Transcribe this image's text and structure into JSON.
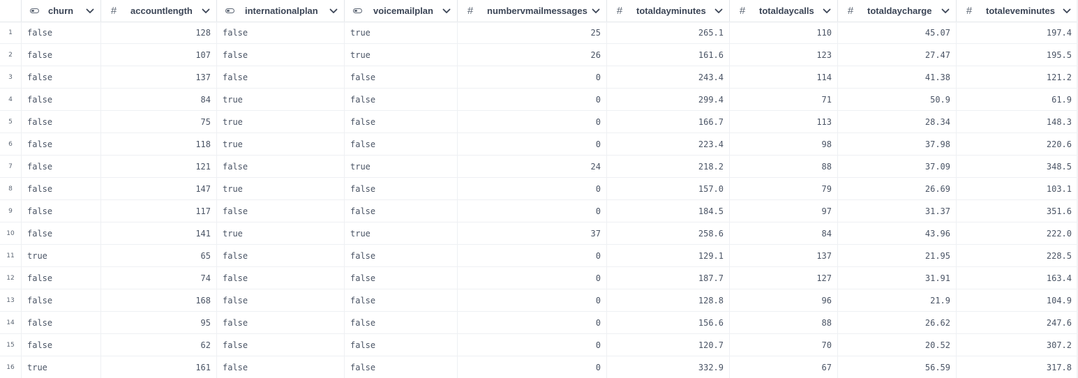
{
  "columns": [
    {
      "key": "churn",
      "label": "churn",
      "type": "boolean",
      "align": "left"
    },
    {
      "key": "accountlength",
      "label": "accountlength",
      "type": "number",
      "align": "right"
    },
    {
      "key": "internationalplan",
      "label": "internationalplan",
      "type": "boolean",
      "align": "left"
    },
    {
      "key": "voicemailplan",
      "label": "voicemailplan",
      "type": "boolean",
      "align": "left"
    },
    {
      "key": "numbervmailmessages",
      "label": "numbervmailmessages",
      "type": "number",
      "align": "right"
    },
    {
      "key": "totaldayminutes",
      "label": "totaldayminutes",
      "type": "number",
      "align": "right"
    },
    {
      "key": "totaldaycalls",
      "label": "totaldaycalls",
      "type": "number",
      "align": "right"
    },
    {
      "key": "totaldaycharge",
      "label": "totaldaycharge",
      "type": "number",
      "align": "right"
    },
    {
      "key": "totaleveminutes",
      "label": "totaleveminutes",
      "type": "number",
      "align": "right"
    }
  ],
  "rows": [
    {
      "index": "1",
      "cells": [
        "false",
        "128",
        "false",
        "true",
        "25",
        "265.1",
        "110",
        "45.07",
        "197.4"
      ]
    },
    {
      "index": "2",
      "cells": [
        "false",
        "107",
        "false",
        "true",
        "26",
        "161.6",
        "123",
        "27.47",
        "195.5"
      ]
    },
    {
      "index": "3",
      "cells": [
        "false",
        "137",
        "false",
        "false",
        "0",
        "243.4",
        "114",
        "41.38",
        "121.2"
      ]
    },
    {
      "index": "4",
      "cells": [
        "false",
        "84",
        "true",
        "false",
        "0",
        "299.4",
        "71",
        "50.9",
        "61.9"
      ]
    },
    {
      "index": "5",
      "cells": [
        "false",
        "75",
        "true",
        "false",
        "0",
        "166.7",
        "113",
        "28.34",
        "148.3"
      ]
    },
    {
      "index": "6",
      "cells": [
        "false",
        "118",
        "true",
        "false",
        "0",
        "223.4",
        "98",
        "37.98",
        "220.6"
      ]
    },
    {
      "index": "7",
      "cells": [
        "false",
        "121",
        "false",
        "true",
        "24",
        "218.2",
        "88",
        "37.09",
        "348.5"
      ]
    },
    {
      "index": "8",
      "cells": [
        "false",
        "147",
        "true",
        "false",
        "0",
        "157.0",
        "79",
        "26.69",
        "103.1"
      ]
    },
    {
      "index": "9",
      "cells": [
        "false",
        "117",
        "false",
        "false",
        "0",
        "184.5",
        "97",
        "31.37",
        "351.6"
      ]
    },
    {
      "index": "10",
      "cells": [
        "false",
        "141",
        "true",
        "true",
        "37",
        "258.6",
        "84",
        "43.96",
        "222.0"
      ]
    },
    {
      "index": "11",
      "cells": [
        "true",
        "65",
        "false",
        "false",
        "0",
        "129.1",
        "137",
        "21.95",
        "228.5"
      ]
    },
    {
      "index": "12",
      "cells": [
        "false",
        "74",
        "false",
        "false",
        "0",
        "187.7",
        "127",
        "31.91",
        "163.4"
      ]
    },
    {
      "index": "13",
      "cells": [
        "false",
        "168",
        "false",
        "false",
        "0",
        "128.8",
        "96",
        "21.9",
        "104.9"
      ]
    },
    {
      "index": "14",
      "cells": [
        "false",
        "95",
        "false",
        "false",
        "0",
        "156.6",
        "88",
        "26.62",
        "247.6"
      ]
    },
    {
      "index": "15",
      "cells": [
        "false",
        "62",
        "false",
        "false",
        "0",
        "120.7",
        "70",
        "20.52",
        "307.2"
      ]
    },
    {
      "index": "16",
      "cells": [
        "true",
        "161",
        "false",
        "false",
        "0",
        "332.9",
        "67",
        "56.59",
        "317.8"
      ]
    }
  ],
  "icons": {
    "number_type": "#",
    "boolean_type": "toggle-icon",
    "sort_menu": "chevron-down-icon"
  },
  "colors": {
    "header_text": "#3b4556",
    "cell_text": "#4a5465",
    "grid_line": "#eef0f3"
  }
}
